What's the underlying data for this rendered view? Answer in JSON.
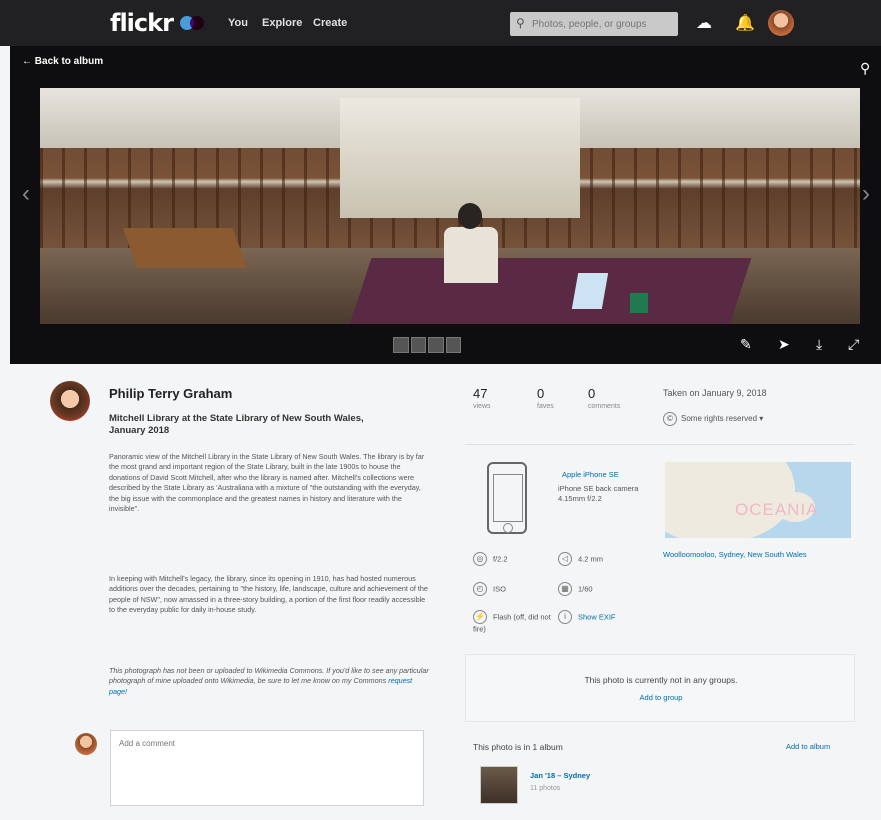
{
  "nav": {
    "logo": "flickr",
    "links": [
      "You",
      "Explore",
      "Create"
    ],
    "search_placeholder": "Photos, people, or groups"
  },
  "viewer": {
    "back_label": "Back to album"
  },
  "photo": {
    "author": "Philip Terry Graham",
    "title": "Mitchell Library at the State Library of New South Wales, January 2018",
    "description": [
      "Panoramic view of the Mitchell Library in the State Library of New South Wales. The library is by far the most grand and important region of the State Library, built in the late 1900s to house the donations of David Scott Mitchell, after who the library is named after. Mitchell's collections were described by the State Library as 'Australiana with a mixture of \"the outstanding with the everyday, the big issue with the commonplace and the greatest names in history and literature with the invisible\".",
      "In keeping with Mitchell's legacy, the library, since its opening in 1910, has had hosted numerous additions over the decades, pertaining to \"the history, life, landscape, culture and achievement of the people of NSW\", now amassed in a three-story building, a portion of the first floor readily accessible to the everyday public for daily in-house study."
    ],
    "commons_note": "This photograph has not been or uploaded to Wikimedia Commons. If you'd like to see any particular photograph of mine uploaded onto Wikimedia, be sure to let me know on my Commons ",
    "commons_link": "request page!"
  },
  "stats": [
    {
      "value": "47",
      "label": "views"
    },
    {
      "value": "0",
      "label": "faves"
    },
    {
      "value": "0",
      "label": "comments"
    }
  ],
  "taken": "Taken on January 9, 2018",
  "rights": "Some rights reserved",
  "camera": {
    "name": "Apple iPhone SE",
    "lens": "iPhone SE back camera 4.15mm f/2.2"
  },
  "exif": {
    "aperture": "f/2.2",
    "focal": "4.2 mm",
    "iso": "ISO",
    "exposure": "1/60",
    "flash": "Flash (off, did not fire)",
    "show_exif": "Show EXIF"
  },
  "map": {
    "label": "OCEANIA"
  },
  "location": "Woolloomooloo, Sydney, New South Wales",
  "groups": {
    "text": "This photo is currently not in any groups.",
    "add": "Add to group"
  },
  "albums": {
    "header": "This photo is in 1 album",
    "add": "Add to album",
    "name": "Jan '18 – Sydney",
    "count": "11 photos"
  },
  "comment": {
    "placeholder": "Add a comment"
  }
}
